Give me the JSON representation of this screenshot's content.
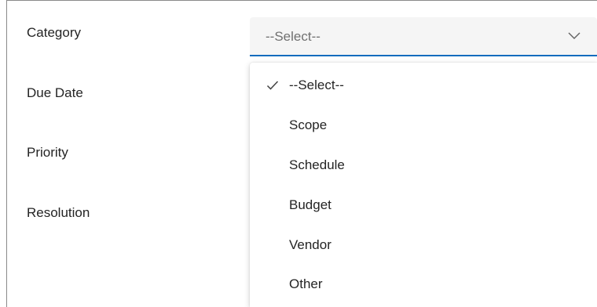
{
  "form": {
    "labels": {
      "category": "Category",
      "due_date": "Due Date",
      "priority": "Priority",
      "resolution": "Resolution"
    },
    "category_select": {
      "selected_value": "--Select--",
      "expanded": true,
      "icon": "chevron-down-icon",
      "accent_color": "#0f6cbd"
    },
    "dropdown": {
      "options": [
        {
          "label": "--Select--",
          "selected": true
        },
        {
          "label": "Scope",
          "selected": false
        },
        {
          "label": "Schedule",
          "selected": false
        },
        {
          "label": "Budget",
          "selected": false
        },
        {
          "label": "Vendor",
          "selected": false
        },
        {
          "label": "Other",
          "selected": false
        }
      ]
    }
  }
}
